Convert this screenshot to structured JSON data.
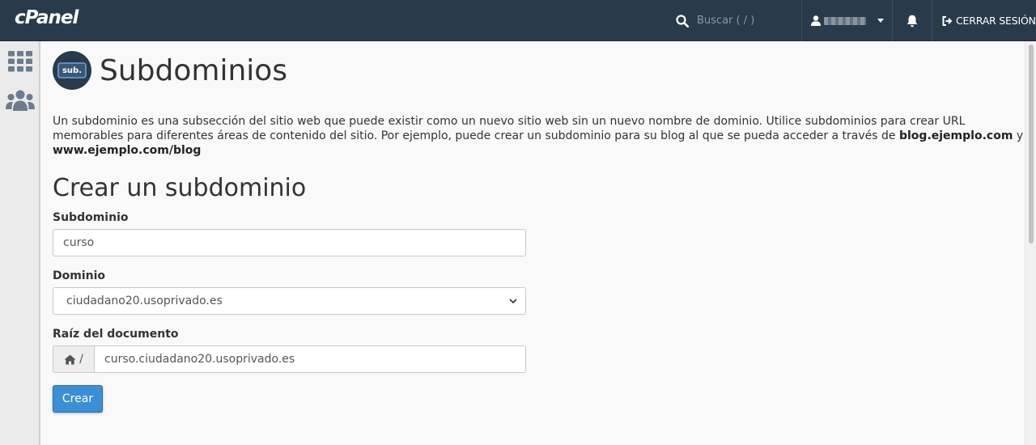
{
  "header": {
    "logo_text": "cPanel",
    "search_placeholder": "Buscar ( / )",
    "logout_label": "CERRAR SESIÓN"
  },
  "sidebar": {
    "items": [
      {
        "name": "home-grid",
        "icon": "grid-icon"
      },
      {
        "name": "users",
        "icon": "users-icon"
      }
    ]
  },
  "main": {
    "page_title": "Subdominios",
    "app_icon_text": "sub.",
    "description_part1": "Un subdominio es una subsección del sitio web que puede existir como un nuevo sitio web sin un nuevo nombre de dominio. Utilice subdominios para crear URL memorables para diferentes áreas de contenido del sitio. Por ejemplo, puede crear un subdominio para su blog al que se pueda acceder a través de ",
    "description_bold1": "blog.ejemplo.com",
    "description_mid": " y ",
    "description_bold2": "www.ejemplo.com/blog",
    "section_title": "Crear un subdominio",
    "form": {
      "subdomain_label": "Subdominio",
      "subdomain_value": "curso",
      "domain_label": "Dominio",
      "domain_value": "ciudadano20.usoprivado.es",
      "docroot_label": "Raíz del documento",
      "docroot_prefix": "/",
      "docroot_value": "curso.ciudadano20.usoprivado.es",
      "submit_label": "Crear"
    }
  },
  "colors": {
    "topbar": "#293a4a",
    "primary_button": "#3b8fd6",
    "background": "#f9f9f9"
  }
}
